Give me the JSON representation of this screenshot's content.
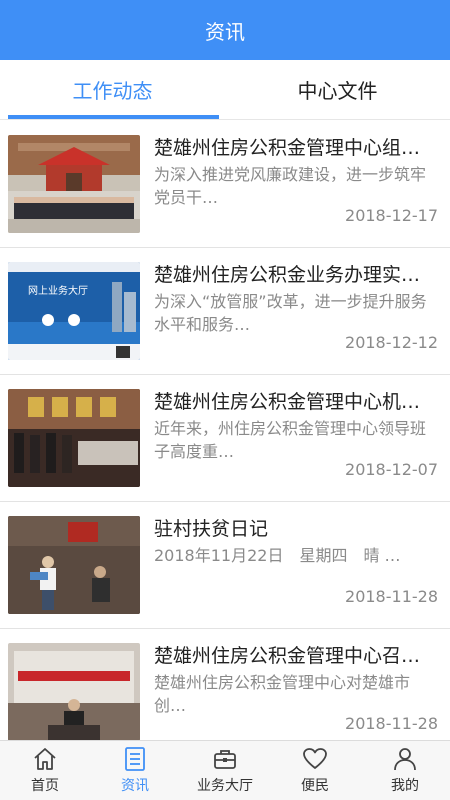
{
  "header": {
    "title": "资讯"
  },
  "tabs": [
    {
      "label": "工作动态",
      "active": true
    },
    {
      "label": "中心文件",
      "active": false
    }
  ],
  "articles": [
    {
      "title": "楚雄州住房公积金管理中心组…",
      "summary": "为深入推进党风廉政建设，进一步筑牢党员干…",
      "date": "2018-12-17",
      "thumb": "group-photo"
    },
    {
      "title": "楚雄州住房公积金业务办理实…",
      "summary": "为深入“放管服”改革，进一步提升服务水平和服务…",
      "date": "2018-12-12",
      "thumb": "online-service-hall",
      "thumb_text": "网上业务大厅"
    },
    {
      "title": "楚雄州住房公积金管理中心机…",
      "summary": "近年来，州住房公积金管理中心领导班子高度重…",
      "date": "2018-12-07",
      "thumb": "meeting-room"
    },
    {
      "title": "驻村扶贫日记",
      "summary": "2018年11月22日　星期四　晴 …",
      "date": "2018-11-28",
      "thumb": "village-visit"
    },
    {
      "title": "楚雄州住房公积金管理中心召…",
      "summary": "楚雄州住房公积金管理中心对楚雄市创…",
      "date": "2018-11-28",
      "thumb": "conference"
    }
  ],
  "tabbar": [
    {
      "label": "首页",
      "icon": "home-icon",
      "active": false
    },
    {
      "label": "资讯",
      "icon": "news-icon",
      "active": true
    },
    {
      "label": "业务大厅",
      "icon": "briefcase-icon",
      "active": false
    },
    {
      "label": "便民",
      "icon": "heart-icon",
      "active": false
    },
    {
      "label": "我的",
      "icon": "user-icon",
      "active": false
    }
  ],
  "colors": {
    "primary": "#3f8ff6",
    "text": "#222222",
    "muted": "#8a8a8a"
  }
}
